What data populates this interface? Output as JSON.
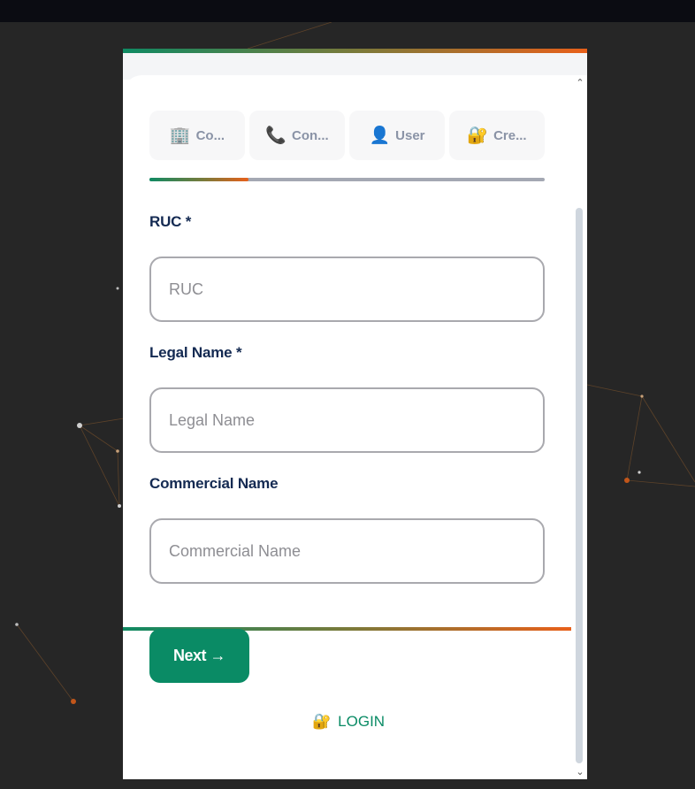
{
  "tabs": [
    {
      "icon": "🏢",
      "icon_name": "building-icon",
      "label": "Co...",
      "active": true
    },
    {
      "icon": "📞",
      "icon_name": "phone-icon",
      "label": "Con...",
      "active": false
    },
    {
      "icon": "👤",
      "icon_name": "user-icon",
      "label": "User",
      "active": false
    },
    {
      "icon": "🔐",
      "icon_name": "lock-icon",
      "label": "Cre...",
      "active": false
    }
  ],
  "progress": {
    "fraction": 0.25
  },
  "form": {
    "ruc": {
      "label": "RUC *",
      "placeholder": "RUC",
      "value": ""
    },
    "legal_name": {
      "label": "Legal Name *",
      "placeholder": "Legal Name",
      "value": ""
    },
    "commercial_name": {
      "label": "Commercial Name",
      "placeholder": "Commercial Name",
      "value": ""
    }
  },
  "actions": {
    "next_label": "Next →",
    "login_icon": "🔐",
    "login_label": "LOGIN"
  },
  "colors": {
    "primary": "#0a8b65",
    "accent": "#e8601a",
    "label": "#142a52",
    "background": "#262626"
  }
}
